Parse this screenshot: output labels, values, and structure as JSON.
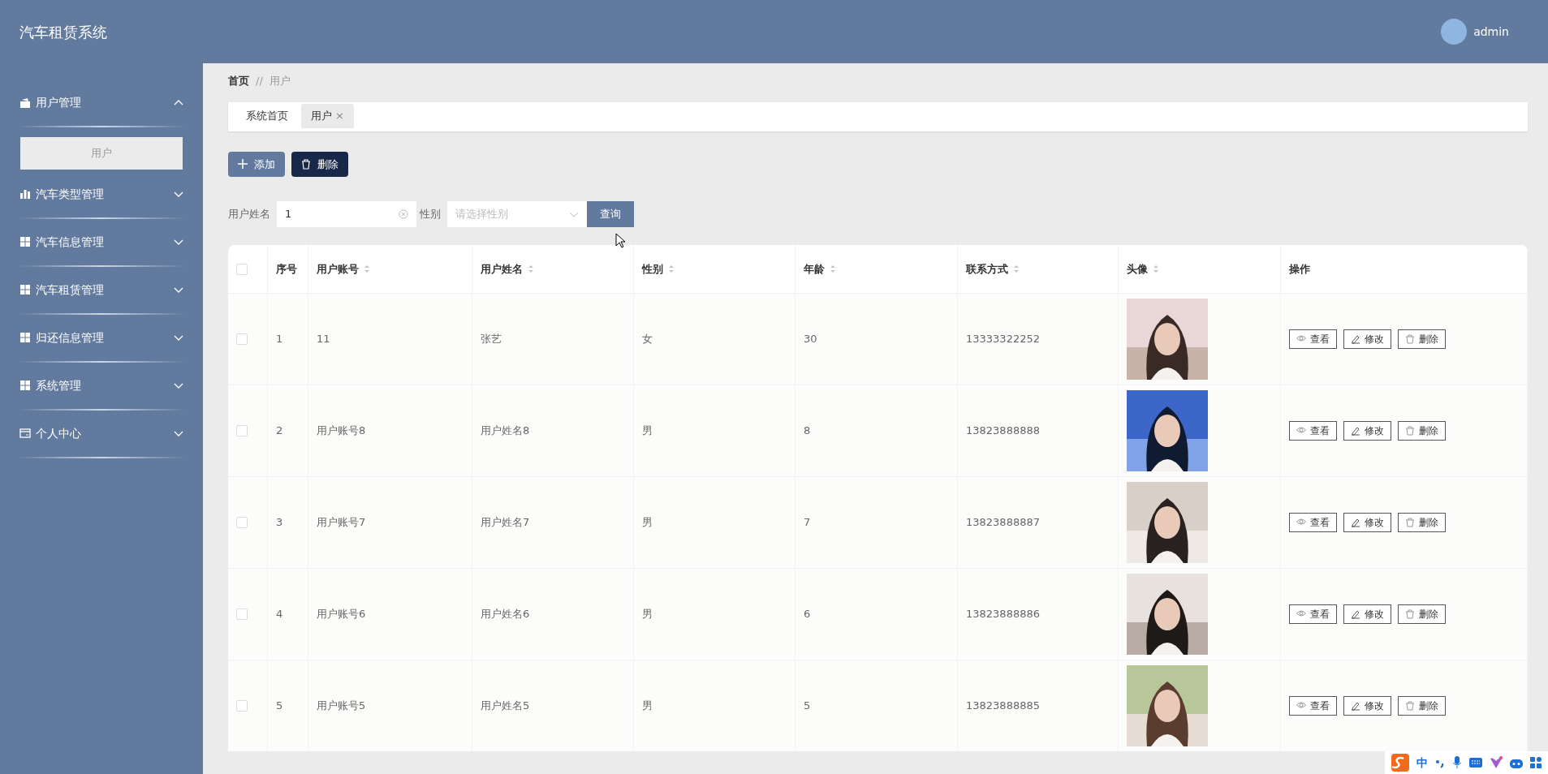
{
  "header": {
    "title": "汽车租赁系统",
    "user": "admin"
  },
  "sidebar": {
    "items": [
      {
        "label": "用户管理",
        "kind": "wallet",
        "expanded": true,
        "children": [
          {
            "label": "用户",
            "selected": true
          }
        ]
      },
      {
        "label": "汽车类型管理",
        "kind": "chart",
        "expanded": false
      },
      {
        "label": "汽车信息管理",
        "kind": "grid",
        "expanded": false
      },
      {
        "label": "汽车租赁管理",
        "kind": "grid",
        "expanded": false
      },
      {
        "label": "归还信息管理",
        "kind": "grid",
        "expanded": false
      },
      {
        "label": "系统管理",
        "kind": "grid",
        "expanded": false
      },
      {
        "label": "个人中心",
        "kind": "card",
        "expanded": false
      }
    ]
  },
  "breadcrumb": [
    "首页",
    "//",
    "用户"
  ],
  "tabs": [
    {
      "label": "系统首页",
      "selected": false,
      "closable": false
    },
    {
      "label": "用户",
      "selected": true,
      "closable": true,
      "close": "×"
    }
  ],
  "actions": [
    {
      "label": "添加",
      "kind": "add"
    },
    {
      "label": "删除",
      "kind": "delete"
    }
  ],
  "search": {
    "name_label": "用户姓名",
    "name_value": "1",
    "gender_label": "性别",
    "gender_placeholder": "请选择性别",
    "button": "查询"
  },
  "table": {
    "select_all": {
      "checked": false
    },
    "columns": [
      {
        "label": "序号",
        "sortable": false
      },
      {
        "label": "用户账号",
        "sortable": true
      },
      {
        "label": "用户姓名",
        "sortable": true
      },
      {
        "label": "性别",
        "sortable": true
      },
      {
        "label": "年龄",
        "sortable": true
      },
      {
        "label": "联系方式",
        "sortable": true
      },
      {
        "label": "头像",
        "sortable": true
      },
      {
        "label": "操作",
        "sortable": false
      }
    ],
    "rows": [
      {
        "checked": false,
        "cells": [
          "1",
          "11",
          "张艺",
          "女",
          "30",
          "13333322252"
        ],
        "actions": [
          {
            "label": "查看",
            "kind": "view"
          },
          {
            "label": "修改",
            "kind": "edit"
          },
          {
            "label": "删除",
            "kind": "delete"
          }
        ]
      },
      {
        "checked": false,
        "cells": [
          "2",
          "用户账号8",
          "用户姓名8",
          "男",
          "8",
          "13823888888"
        ],
        "actions": [
          {
            "label": "查看",
            "kind": "view"
          },
          {
            "label": "修改",
            "kind": "edit"
          },
          {
            "label": "删除",
            "kind": "delete"
          }
        ]
      },
      {
        "checked": false,
        "cells": [
          "3",
          "用户账号7",
          "用户姓名7",
          "男",
          "7",
          "13823888887"
        ],
        "actions": [
          {
            "label": "查看",
            "kind": "view"
          },
          {
            "label": "修改",
            "kind": "edit"
          },
          {
            "label": "删除",
            "kind": "delete"
          }
        ]
      },
      {
        "checked": false,
        "cells": [
          "4",
          "用户账号6",
          "用户姓名6",
          "男",
          "6",
          "13823888886"
        ],
        "actions": [
          {
            "label": "查看",
            "kind": "view"
          },
          {
            "label": "修改",
            "kind": "edit"
          },
          {
            "label": "删除",
            "kind": "delete"
          }
        ]
      },
      {
        "checked": false,
        "cells": [
          "5",
          "用户账号5",
          "用户姓名5",
          "男",
          "5",
          "13823888885"
        ],
        "actions": [
          {
            "label": "查看",
            "kind": "view"
          },
          {
            "label": "修改",
            "kind": "edit"
          },
          {
            "label": "删除",
            "kind": "delete"
          }
        ]
      }
    ]
  },
  "ime": {
    "mode": "中"
  }
}
